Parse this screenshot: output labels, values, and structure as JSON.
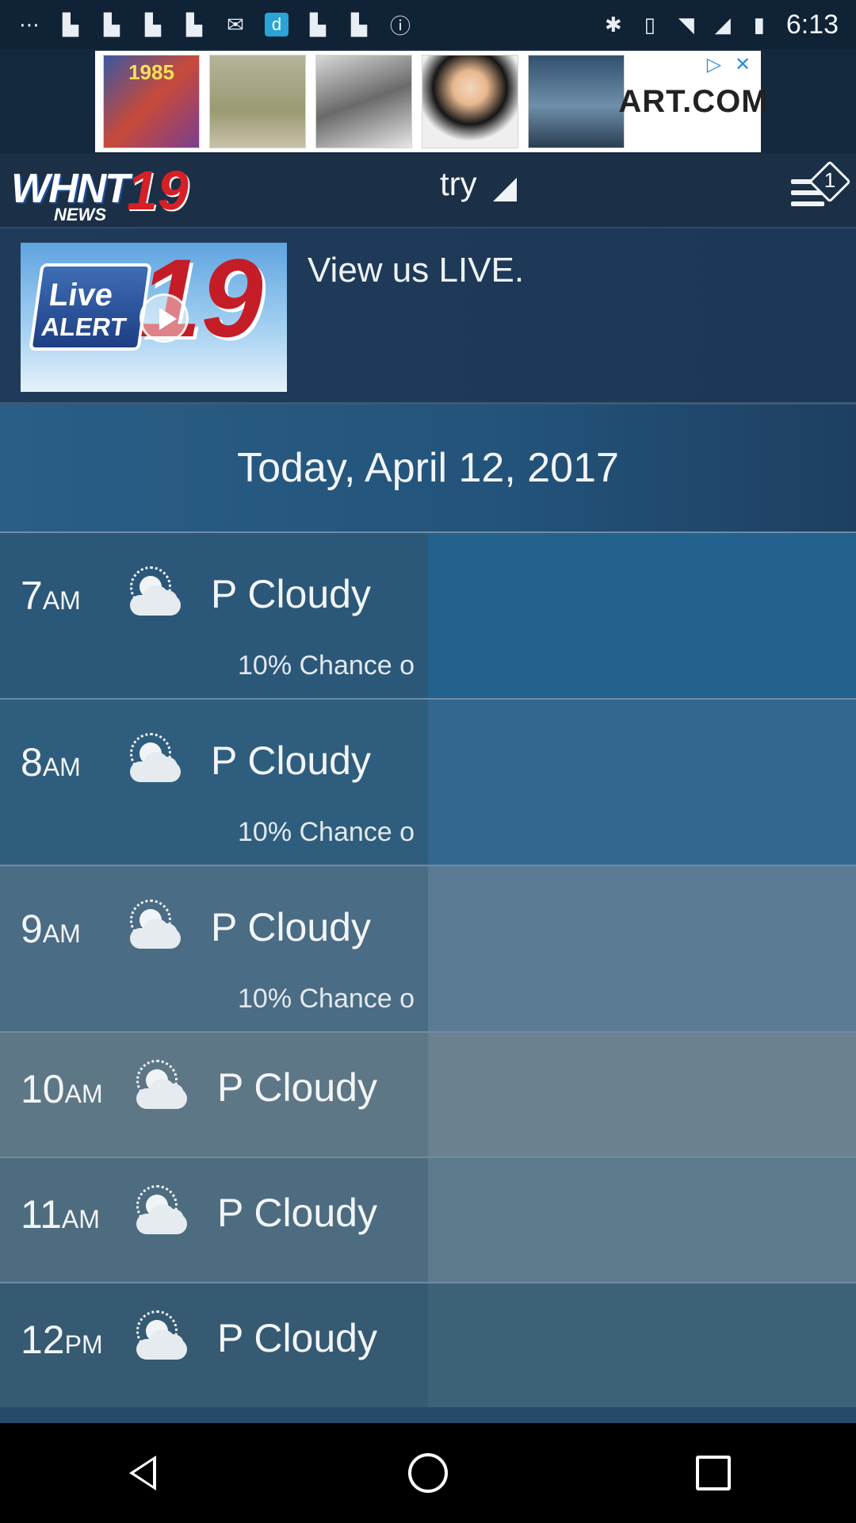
{
  "status_bar": {
    "time": "6:13",
    "icons_left": [
      "more-icon",
      "flipboard-icon",
      "flipboard-icon",
      "flipboard-icon",
      "flipboard-icon",
      "mail-icon",
      "dictionary-icon",
      "flipboard-icon",
      "flipboard-icon",
      "info-icon"
    ],
    "icons_right": [
      "bluetooth-icon",
      "vibrate-icon",
      "wifi-icon",
      "signal-icon",
      "battery-icon"
    ]
  },
  "ad": {
    "brand": "ART.COM",
    "thumb_label": "1985",
    "colors": {
      "background": "#ffffff",
      "choices": "#2e8cd6"
    }
  },
  "header": {
    "logo": {
      "main": "WHNT",
      "sub": "NEWS",
      "number": "19"
    },
    "location": "try",
    "notification_count": "1"
  },
  "live": {
    "thumb_title": "Live",
    "thumb_sub": "ALERT",
    "thumb_number": "19",
    "text": "View us LIVE."
  },
  "forecast": {
    "date": "Today, April 12, 2017",
    "hours": [
      {
        "hour": "7",
        "ampm": "AM",
        "condition": "P Cloudy",
        "precip": "10% Chance o",
        "right_color": "#23628c"
      },
      {
        "hour": "8",
        "ampm": "AM",
        "condition": "P Cloudy",
        "precip": "10% Chance o",
        "right_color": "#33678f"
      },
      {
        "hour": "9",
        "ampm": "AM",
        "condition": "P Cloudy",
        "precip": "10% Chance o",
        "right_color": "#5a7b93"
      },
      {
        "hour": "10",
        "ampm": "AM",
        "condition": "P Cloudy",
        "precip": "",
        "right_color": "#6c8190"
      },
      {
        "hour": "11",
        "ampm": "AM",
        "condition": "P Cloudy",
        "precip": "",
        "right_color": "#5c7a8c"
      },
      {
        "hour": "12",
        "ampm": "PM",
        "condition": "P Cloudy",
        "precip": "",
        "right_color": "#3c6277"
      }
    ]
  },
  "colors": {
    "status_bar": "#0f2236",
    "header": "#1b2f46",
    "accent_red": "#d52026"
  }
}
